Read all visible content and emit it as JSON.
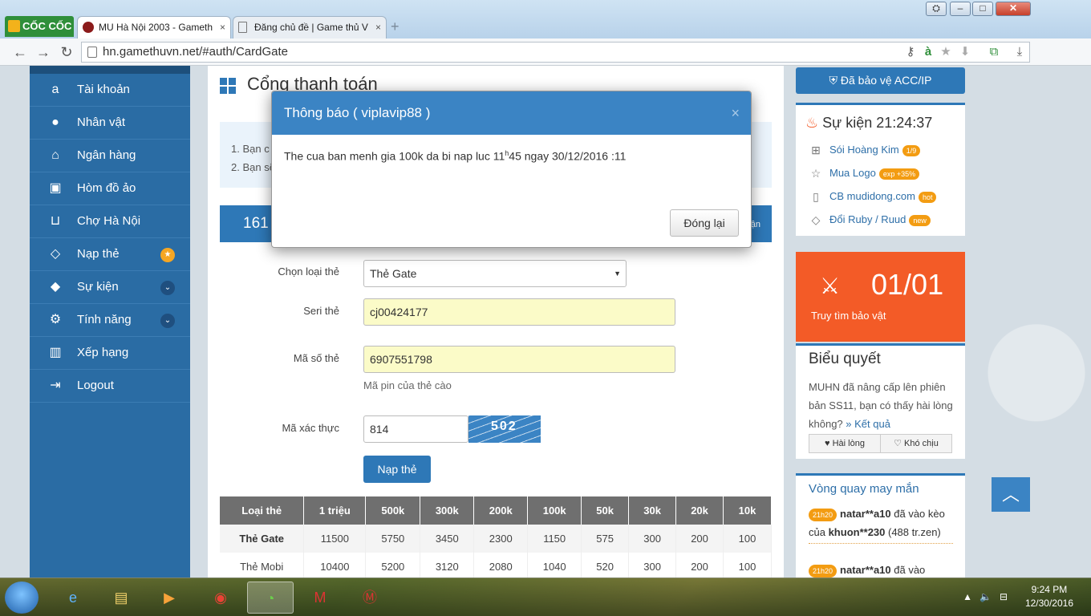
{
  "browser": {
    "brand": "CỐC CỐC",
    "tabs": [
      {
        "title": "MU Hà Nội 2003 - Gameth"
      },
      {
        "title": "Đăng chủ đề | Game thủ V"
      }
    ],
    "url": "hn.gamethuvn.net/#auth/CardGate"
  },
  "sidebar": {
    "items": [
      {
        "label": "Tài khoản",
        "icon": "amazon-icon"
      },
      {
        "label": "Nhân vật",
        "icon": "user-icon"
      },
      {
        "label": "Ngân hàng",
        "icon": "bank-icon"
      },
      {
        "label": "Hòm đồ ảo",
        "icon": "briefcase-icon"
      },
      {
        "label": "Chợ Hà Nội",
        "icon": "cart-icon"
      },
      {
        "label": "Nạp thẻ",
        "icon": "diamond-icon",
        "badge": "★"
      },
      {
        "label": "Sự kiện",
        "icon": "android-icon",
        "badge": "⌄"
      },
      {
        "label": "Tính năng",
        "icon": "gears-icon",
        "badge": "⌄"
      },
      {
        "label": "Xếp hạng",
        "icon": "bar-chart-icon"
      },
      {
        "label": "Logout",
        "icon": "logout-icon"
      }
    ]
  },
  "main": {
    "title": "Cổng thanh toán",
    "info_lines": [
      "1. Bạn c",
      "2. Bạn sẽ"
    ],
    "balance": "161",
    "balance_tail": "ận",
    "form": {
      "card_type_label": "Chọn loại thẻ",
      "card_type_value": "Thẻ Gate",
      "serial_label": "Seri thẻ",
      "serial_value": "cj00424177",
      "pin_label": "Mã số thẻ",
      "pin_value": "6907551798",
      "pin_hint": "Mã pin của thẻ cào",
      "captcha_label": "Mã xác thực",
      "captcha_value": "814",
      "captcha_image_text": "502",
      "submit_label": "Nạp thẻ"
    },
    "rates": {
      "headers": [
        "Loại thẻ",
        "1 triệu",
        "500k",
        "300k",
        "200k",
        "100k",
        "50k",
        "30k",
        "20k",
        "10k"
      ],
      "rows": [
        [
          "Thẻ Gate",
          "11500",
          "5750",
          "3450",
          "2300",
          "1150",
          "575",
          "300",
          "200",
          "100"
        ],
        [
          "Thẻ Mobi",
          "10400",
          "5200",
          "3120",
          "2080",
          "1040",
          "520",
          "300",
          "200",
          "100"
        ]
      ]
    }
  },
  "right": {
    "protect_label": "Đã bảo vệ ACC/IP",
    "event_title": "Sự kiện 21:24:37",
    "events": [
      {
        "label": "Sói Hoàng Kim",
        "pill": "1/9",
        "icon": "gift-icon"
      },
      {
        "label": "Mua Logo",
        "pill": "exp +35%",
        "icon": "star-icon"
      },
      {
        "label": "CB mudidong.com",
        "pill": "hot",
        "icon": "mobile-icon"
      },
      {
        "label": "Đổi Ruby / Ruud",
        "pill": "new",
        "icon": "diamond-icon"
      }
    ],
    "treasure_count": "01/01",
    "treasure_label": "Truy tìm bảo vật",
    "poll_title": "Biểu quyết",
    "poll_text": "MUHN đã nâng cấp lên phiên bản SS11, bạn có thấy hài lòng không?",
    "poll_result_link": "» Kết quả",
    "poll_yes": "Hài lòng",
    "poll_no": "Khó chịu",
    "spin_title": "Vòng quay may mắn",
    "spin_entries": [
      {
        "time": "21h20",
        "user": "natar**a10",
        "text_mid": " đã vào kèo của ",
        "target": "khuon**230",
        "text_end": " (488 tr.zen)"
      },
      {
        "time": "21h20",
        "user": "natar**a10",
        "text_mid": " đã vào",
        "target": "",
        "text_end": ""
      }
    ]
  },
  "modal": {
    "title": "Thông báo ( viplavip88 )",
    "message_pre": "The cua ban menh gia 100k da bi nap luc 11",
    "message_sup": "h",
    "message_post": "45 ngay 30/12/2016 :11",
    "close_button": "Đóng lại",
    "close_x": "×"
  },
  "taskbar": {
    "time": "9:24 PM",
    "date": "12/30/2016"
  }
}
